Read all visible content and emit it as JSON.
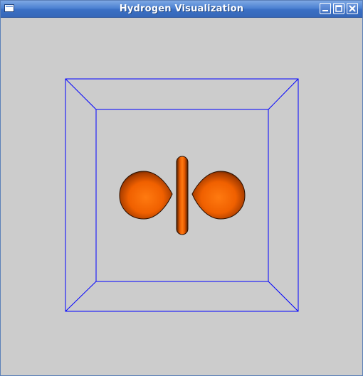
{
  "window": {
    "title": "Hydrogen Visualization"
  },
  "controls": {
    "menu_icon": "window-menu-icon",
    "minimize_icon": "minimize-icon",
    "maximize_icon": "maximize-icon",
    "close_icon": "close-icon"
  },
  "scene": {
    "background_color": "#cccccc",
    "box_color": "#0000ff",
    "orbital_color": "#ff6a00",
    "orbital_edge_color": "#3a1a00"
  }
}
